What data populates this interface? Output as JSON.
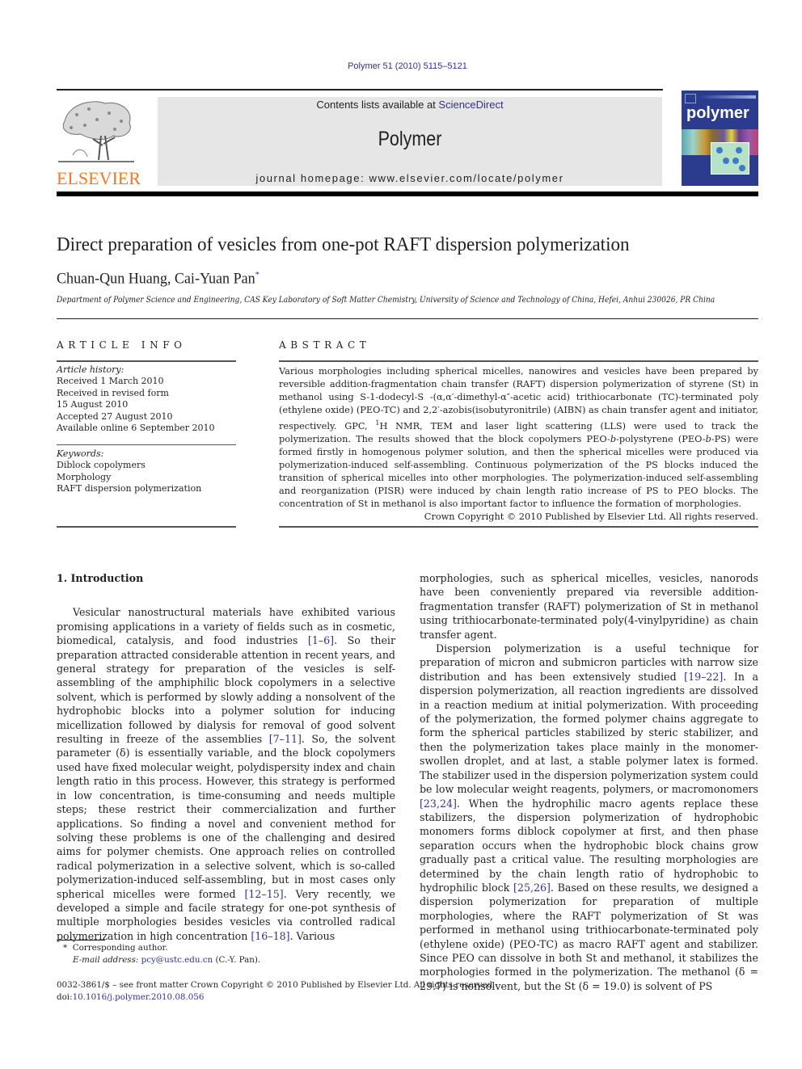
{
  "header": {
    "citation": "Polymer 51 (2010) 5115–5121",
    "publisher_logo_text": "ELSEVIER",
    "contents_prefix": "Contents lists available at ",
    "contents_link": "ScienceDirect",
    "journal_name": "Polymer",
    "homepage": "journal homepage: www.elsevier.com/locate/polymer",
    "cover_title": "polymer",
    "colors": {
      "link": "#2e3192",
      "elsevier_orange": "#f47920",
      "cover_blue": "#2b3c8f",
      "banner_gray": "#e6e6e6"
    }
  },
  "article": {
    "title": "Direct preparation of vesicles from one-pot RAFT dispersion polymerization",
    "authors": "Chuan-Qun Huang, Cai-Yuan Pan",
    "author_mark": "*",
    "affiliation": "Department of Polymer Science and Engineering, CAS Key Laboratory of Soft Matter Chemistry, University of Science and Technology of China, Hefei, Anhui 230026, PR China"
  },
  "article_info": {
    "heading": "ARTICLE INFO",
    "history_label": "Article history:",
    "history": [
      "Received 1 March 2010",
      "Received in revised form",
      "15 August 2010",
      "Accepted 27 August 2010",
      "Available online 6 September 2010"
    ],
    "keywords_label": "Keywords:",
    "keywords": [
      "Diblock copolymers",
      "Morphology",
      "RAFT dispersion polymerization"
    ]
  },
  "abstract": {
    "heading": "ABSTRACT",
    "text_1": "Various morphologies including spherical micelles, nanowires and vesicles have been prepared by reversible addition-fragmentation chain transfer (RAFT) dispersion polymerization of styrene (St) in methanol using S-1-dodecyl-S -(α,α′-dimethyl-α″-acetic acid) trithiocarbonate (TC)-terminated poly (ethylene oxide) (PEO-TC) and 2,2′-azobis(isobutyronitrile) (AIBN) as chain transfer agent and initiator, respectively. GPC, ",
    "nmr_sup": "1",
    "text_2": "H NMR, TEM and laser light scattering (LLS) were used to track the polymerization. The results showed that the block copolymers PEO-",
    "b1": "b",
    "text_3": "-polystyrene (PEO-",
    "b2": "b",
    "text_4": "-PS) were formed firstly in homogenous polymer solution, and then the spherical micelles were produced via polymerization-induced self-assembling. Continuous polymerization of the PS blocks induced the transition of spherical micelles into other morphologies. The polymerization-induced self-assembling and reorganization (PISR) were induced by chain length ratio increase of PS to PEO blocks. The concentration of St in methanol is also important factor to influence the formation of morphologies.",
    "copyright": "Crown Copyright © 2010 Published by Elsevier Ltd. All rights reserved."
  },
  "body": {
    "section_heading": "1.  Introduction",
    "left": {
      "p1_a": "Vesicular nanostructural materials have exhibited various promising applications in a variety of fields such as in cosmetic, biomedical, catalysis, and food industries ",
      "ref1": "[1–6]",
      "p1_b": ". So their preparation attracted considerable attention in recent years, and general strategy for preparation of the vesicles is self-assembling of the amphiphilic block copolymers in a selective solvent, which is performed by slowly adding a nonsolvent of the hydrophobic blocks into a polymer solution for inducing micellization followed by dialysis for removal of good solvent resulting in freeze of the assemblies ",
      "ref2": "[7–11]",
      "p1_c": ". So, the solvent parameter (δ) is essentially variable, and the block copolymers used have fixed molecular weight, polydispersity index and chain length ratio in this process. However, this strategy is performed in low concentration, is time-consuming and needs multiple steps; these restrict their commercialization and further applications. So finding a novel and convenient method for solving these problems is one of the challenging and desired aims for polymer chemists. One approach relies on controlled radical polymerization in a selective solvent, which is so-called polymerization-induced self-assembling, but in most cases only spherical micelles were formed ",
      "ref3": "[12–15]",
      "p1_d": ". Very recently, we developed a simple and facile strategy for one-pot synthesis of multiple morphologies besides vesicles via controlled radical polymerization in high concentration ",
      "ref4": "[16–18]",
      "p1_e": ". Various"
    },
    "right": {
      "p1_cont": "morphologies, such as spherical micelles, vesicles, nanorods have been conveniently prepared via reversible addition-fragmentation transfer (RAFT) polymerization of St in methanol using trithiocarbonate-terminated poly(4-vinylpyridine) as chain transfer agent.",
      "p2_a": "Dispersion polymerization is a useful technique for preparation of micron and submicron particles with narrow size distribution and has been extensively studied ",
      "ref5": "[19–22]",
      "p2_b": ". In a dispersion polymerization, all reaction ingredients are dissolved in a reaction medium at initial polymerization. With proceeding of the polymerization, the formed polymer chains aggregate to form the spherical particles stabilized by steric stabilizer, and then the polymerization takes place mainly in the monomer-swollen droplet, and at last, a stable polymer latex is formed. The stabilizer used in the dispersion polymerization system could be low molecular weight reagents, polymers, or macromonomers ",
      "ref6": "[23,24]",
      "p2_c": ". When the hydrophilic macro agents replace these stabilizers, the dispersion polymerization of hydrophobic monomers forms diblock copolymer at first, and then phase separation occurs when the hydrophobic block chains grow gradually past a critical value. The resulting morphologies are determined by the chain length ratio of hydrophobic to hydrophilic block ",
      "ref7": "[25,26]",
      "p2_d": ". Based on these results, we designed a dispersion polymerization for preparation of multiple morphologies, where the RAFT polymerization of St was performed in methanol using trithiocarbonate-terminated poly (ethylene oxide) (PEO-TC) as macro RAFT agent and stabilizer. Since PEO can dissolve in both St and methanol, it stabilizes the morphologies formed in the polymerization. The methanol (δ = 29.7) is nonsolvent, but the St (δ = 19.0) is solvent of PS"
    }
  },
  "footnote": {
    "mark": "*",
    "corresponding": "Corresponding author.",
    "email_label": "E-mail address:",
    "email": "pcy@ustc.edu.cn",
    "email_suffix": " (C.-Y. Pan)."
  },
  "footer": {
    "issn_line": "0032-3861/$ – see front matter Crown Copyright © 2010 Published by Elsevier Ltd. All rights reserved.",
    "doi_label": "doi:",
    "doi": "10.1016/j.polymer.2010.08.056"
  }
}
